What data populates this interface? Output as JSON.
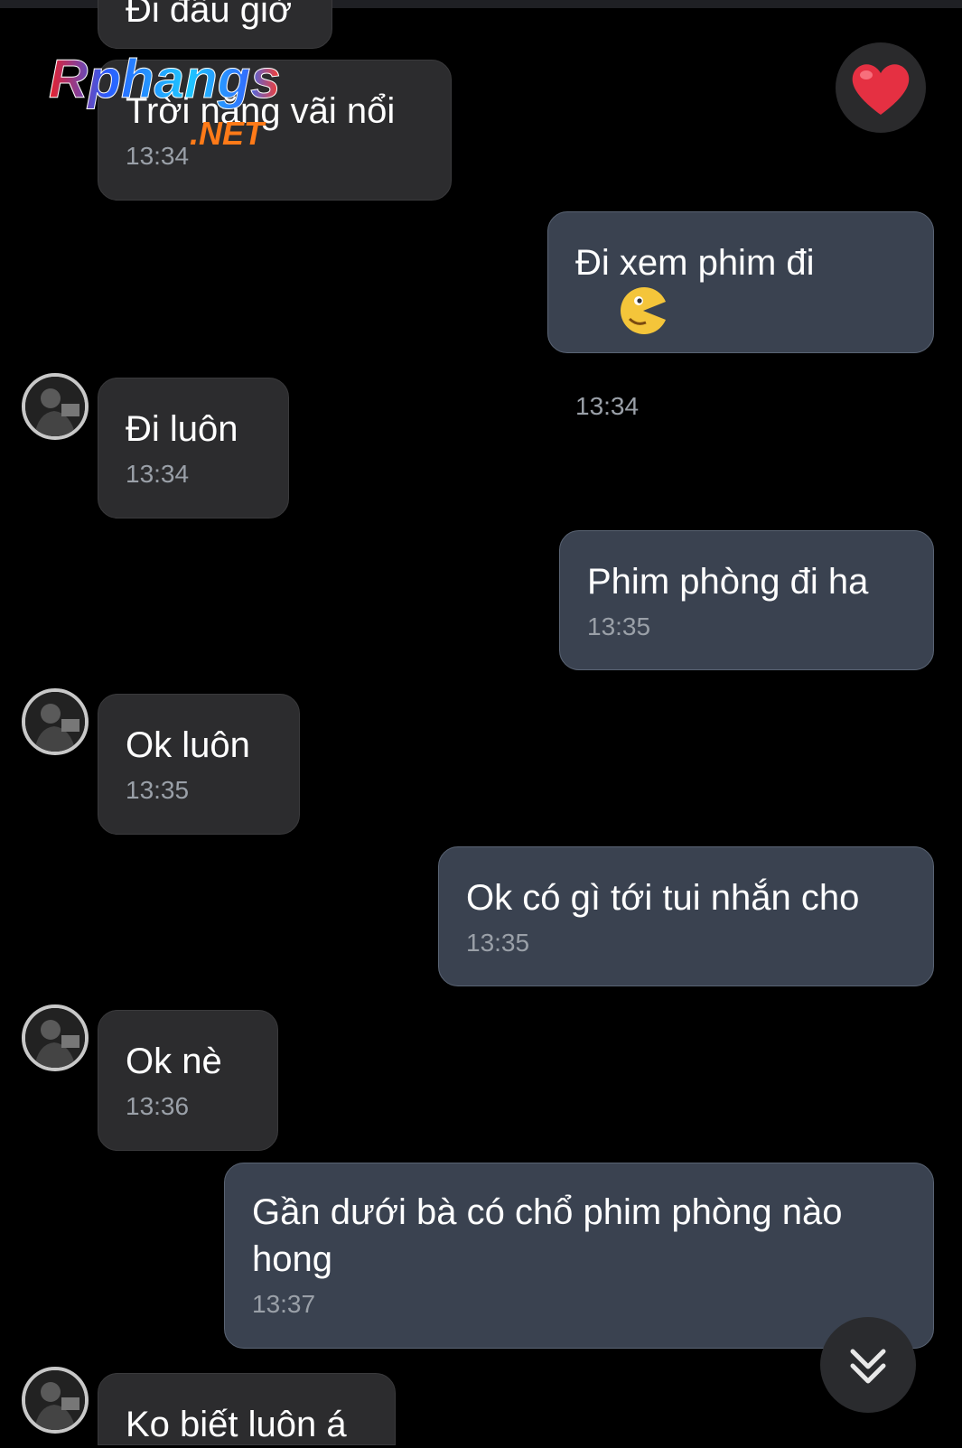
{
  "messages": [
    {
      "side": "received",
      "text": "Đi đâu giờ",
      "time": ""
    },
    {
      "side": "received",
      "text": "Trời nắng vãi nổi",
      "time": "13:34"
    },
    {
      "side": "sent",
      "text": "Đi xem phim đi",
      "time": "13:34"
    },
    {
      "side": "received",
      "text": "Đi luôn",
      "time": "13:34"
    },
    {
      "side": "sent",
      "text": "Phim phòng đi ha",
      "time": "13:35"
    },
    {
      "side": "received",
      "text": "Ok luôn",
      "time": "13:35"
    },
    {
      "side": "sent",
      "text": "Ok có gì tới tui nhắn cho",
      "time": "13:35"
    },
    {
      "side": "received",
      "text": "Ok nè",
      "time": "13:36"
    },
    {
      "side": "sent",
      "text": "Gần dưới bà có chổ phim phòng nào\nhong",
      "time": "13:37"
    },
    {
      "side": "received",
      "text": "Ko biết luôn á",
      "time": ""
    }
  ],
  "watermark": {
    "line1": "Rphangs",
    "line2": ".NET"
  },
  "icons": {
    "heart": "heart-reaction-icon",
    "emoji": "pacman-smile-emoji",
    "scroll": "double-chevron-down-icon",
    "avatar": "contact-avatar"
  },
  "colors": {
    "background": "#000000",
    "received_bubble": "#2c2c2e",
    "sent_bubble": "#3a4250",
    "heart": "#e53042"
  }
}
